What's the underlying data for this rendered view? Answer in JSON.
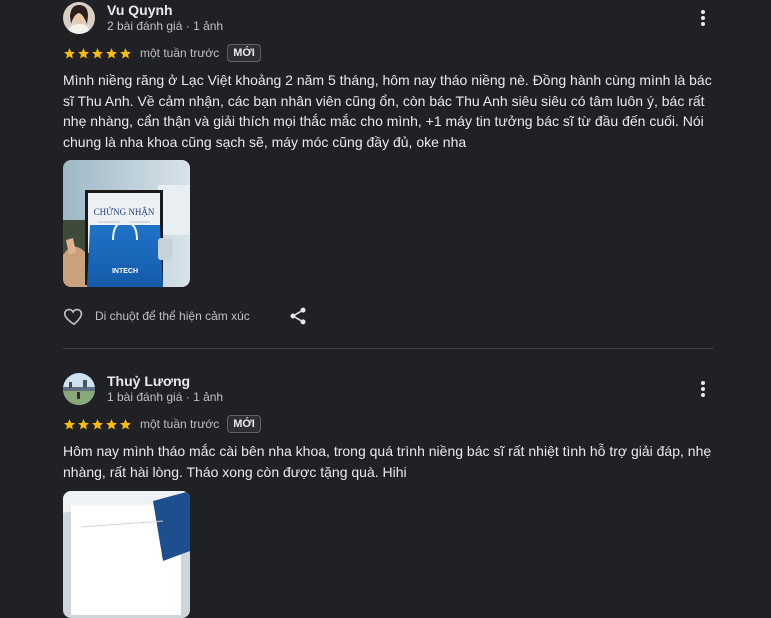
{
  "reviews": [
    {
      "name": "Vu Quynh",
      "meta": "2 bài đánh giá · 1 ảnh",
      "rating": 5,
      "time": "một tuần trước",
      "badge": "MỚI",
      "text": "Mình niềng răng ở Lạc Việt khoảng 2 năm 5 tháng, hôm nay tháo niềng nè. Đồng hành cùng mình là bác sĩ Thu Anh. Về cảm nhận, các bạn nhân viên cũng ổn, còn bác Thu Anh siêu siêu có tâm luôn ý, bác rất nhẹ nhàng, cẩn thận và giải thích mọi thắc mắc cho mình, +1 máy tin tưởng bác sĩ từ đầu đến cuối. Nói chung là nha khoa cũng sạch sẽ, máy móc cũng đầy đủ, oke nha",
      "photo": {
        "certificate_text": "CHỨNG NHẬN",
        "bag_brand": "INTECH"
      },
      "react_label": "Di chuột để thể hiện cảm xúc"
    },
    {
      "name": "Thuỷ Lương",
      "meta": "1 bài đánh giá · 1 ảnh",
      "rating": 5,
      "time": "một tuần trước",
      "badge": "MỚI",
      "text": "Hôm nay mình tháo mắc cài bên nha khoa, trong quá trình niềng bác sĩ rất nhiệt tình hỗ trợ giải đáp, nhẹ nhàng, rất hài lòng. Tháo xong còn được tặng quà. Hihi"
    }
  ],
  "colors": {
    "background": "#202124",
    "star": "#fbbc04",
    "divider": "#3c4043"
  },
  "icons": [
    "more-vert-icon",
    "star-icon",
    "heart-icon",
    "share-icon"
  ]
}
